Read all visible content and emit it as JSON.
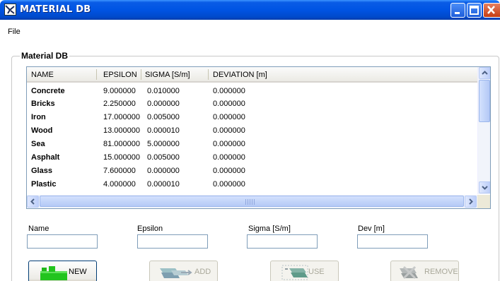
{
  "window": {
    "title": "MATERIAL DB"
  },
  "menu": {
    "file": "File"
  },
  "group": {
    "title": "Material DB"
  },
  "table": {
    "headers": [
      "NAME",
      "EPSILON",
      "SIGMA [S/m]",
      "DEVIATION [m]"
    ],
    "rows": [
      {
        "name": "Concrete",
        "epsilon": "9.000000",
        "sigma": "0.010000",
        "deviation": "0.000000"
      },
      {
        "name": "Bricks",
        "epsilon": "2.250000",
        "sigma": "0.000000",
        "deviation": "0.000000"
      },
      {
        "name": "Iron",
        "epsilon": "17.000000",
        "sigma": "0.005000",
        "deviation": "0.000000"
      },
      {
        "name": "Wood",
        "epsilon": "13.000000",
        "sigma": "0.000010",
        "deviation": "0.000000"
      },
      {
        "name": "Sea",
        "epsilon": "81.000000",
        "sigma": "5.000000",
        "deviation": "0.000000"
      },
      {
        "name": "Asphalt",
        "epsilon": "15.000000",
        "sigma": "0.005000",
        "deviation": "0.000000"
      },
      {
        "name": "Glass",
        "epsilon": "7.600000",
        "sigma": "0.000000",
        "deviation": "0.000000"
      },
      {
        "name": "Plastic",
        "epsilon": "4.000000",
        "sigma": "0.000010",
        "deviation": "0.000000"
      }
    ]
  },
  "fields": {
    "name": {
      "label": "Name",
      "value": ""
    },
    "epsilon": {
      "label": "Epsilon",
      "value": ""
    },
    "sigma": {
      "label": "Sigma [S/m]",
      "value": ""
    },
    "dev": {
      "label": "Dev [m]",
      "value": ""
    }
  },
  "buttons": {
    "new": {
      "label": "NEW",
      "enabled": true,
      "icon": "new-icon"
    },
    "add": {
      "label": "ADD",
      "enabled": false,
      "icon": "add-icon"
    },
    "use": {
      "label": "USE",
      "enabled": false,
      "icon": "use-icon"
    },
    "remove": {
      "label": "REMOVE",
      "enabled": false,
      "icon": "remove-icon"
    }
  },
  "colors": {
    "titlebar": "#0054e3",
    "new_icon_green": "#22c41e",
    "disabled_text": "#a9a89a"
  }
}
